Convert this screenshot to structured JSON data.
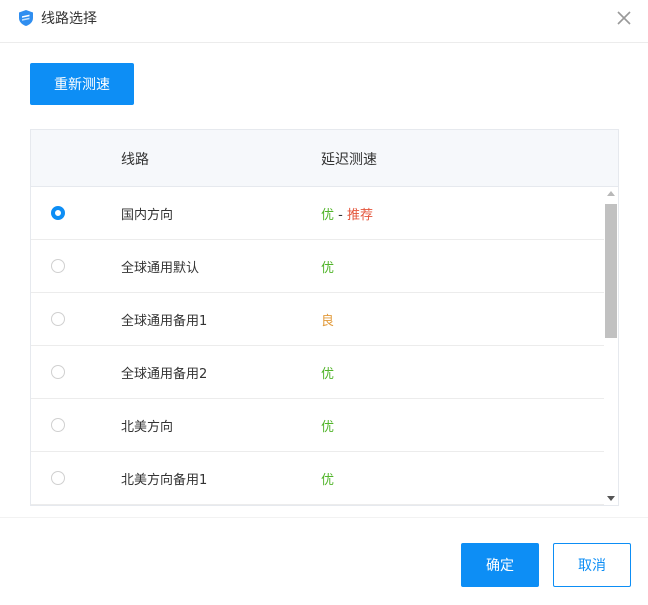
{
  "window": {
    "title": "线路选择",
    "icon": "shield-icon",
    "close_icon": "close-icon"
  },
  "toolbar": {
    "retest_label": "重新测速"
  },
  "table": {
    "headers": {
      "route": "线路",
      "latency": "延迟测速"
    },
    "rows": [
      {
        "name": "国内方向",
        "quality": "优",
        "tag": "推荐",
        "selected": true
      },
      {
        "name": "全球通用默认",
        "quality": "优",
        "tag": "",
        "selected": false
      },
      {
        "name": "全球通用备用1",
        "quality": "良",
        "tag": "",
        "selected": false
      },
      {
        "name": "全球通用备用2",
        "quality": "优",
        "tag": "",
        "selected": false
      },
      {
        "name": "北美方向",
        "quality": "优",
        "tag": "",
        "selected": false
      },
      {
        "name": "北美方向备用1",
        "quality": "优",
        "tag": "",
        "selected": false
      }
    ],
    "separator": " - "
  },
  "footer": {
    "confirm_label": "确定",
    "cancel_label": "取消"
  },
  "colors": {
    "accent": "#0d8ef5",
    "good": "#52b52b",
    "fair": "#e29b3c",
    "recommend": "#e4553b"
  }
}
